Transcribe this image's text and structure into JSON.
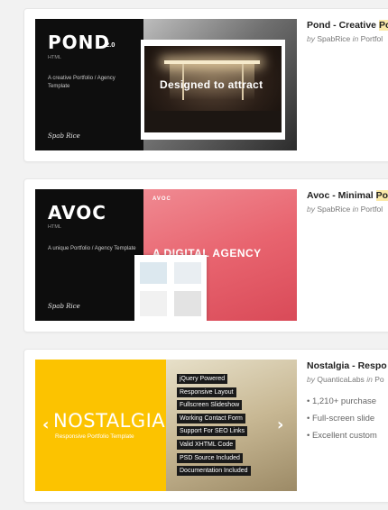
{
  "items": [
    {
      "title_main": "Pond - Creative ",
      "title_highlight": "Po",
      "byline_prefix": "by",
      "author": "SpabRice",
      "in_word": "in",
      "category": "Portfol",
      "thumb": {
        "logo": "POND",
        "version": "2.0",
        "html": "HTML",
        "tagline": "A creative Portfolio / Agency Template",
        "signature": "Spab Rice",
        "caption": "Designed to attract"
      }
    },
    {
      "title_main": "Avoc - Minimal ",
      "title_highlight": "Po",
      "byline_prefix": "by",
      "author": "SpabRice",
      "in_word": "in",
      "category": "Portfol",
      "thumb": {
        "logo": "AVOC",
        "html": "HTML",
        "tagline": "A unique Portfolio / Agency Template",
        "signature": "Spab Rice",
        "mini_logo": "AVOC",
        "headline": "A DIGITAL AGENCY"
      }
    },
    {
      "title_main": "Nostalgia - Respo",
      "byline_prefix": "by",
      "author": "QuanticaLabs",
      "in_word": "in",
      "category": "Po",
      "bullets": [
        "1,210+ purchase",
        "Full-screen slide",
        "Excellent custom"
      ],
      "thumb": {
        "logo": "NOSTALGIA",
        "subtitle": "Responsive Portfolio Template",
        "features": [
          "jQuery Powered",
          "Responsive Layout",
          "Fullscreen Slideshow",
          "Working Contact Form",
          "Support For SEO Links",
          "Valid XHTML Code",
          "PSD Source Included",
          "Documentation Included"
        ],
        "prev_arrow": "‹",
        "next_arrow": "›"
      }
    }
  ],
  "colors": {
    "page_bg": "#f2f2f2",
    "highlight": "#fbe9a8",
    "nostalgia_yellow": "#fcc300",
    "avoc_red": "#e8646f"
  }
}
